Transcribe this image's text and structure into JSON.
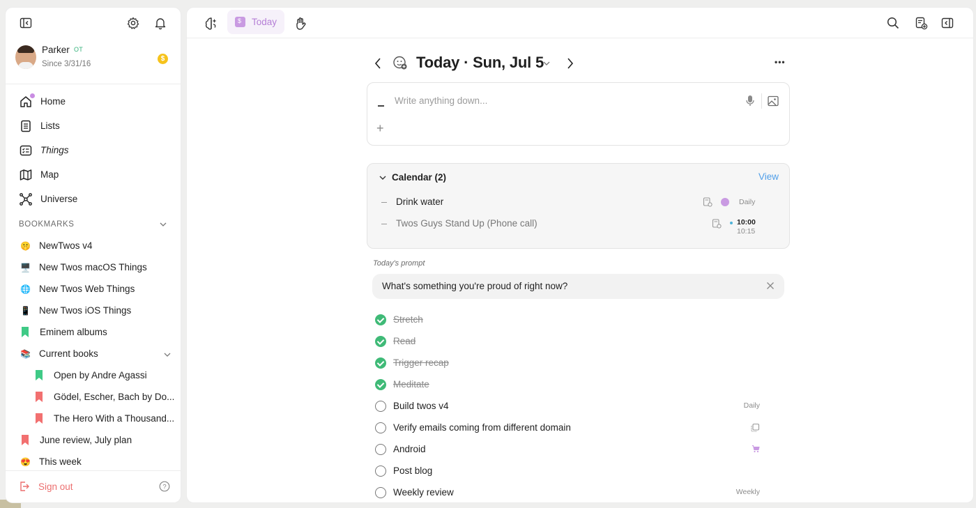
{
  "sidebar": {
    "icons": [
      "sidebar-toggle-icon",
      "gear-icon",
      "bell-icon"
    ],
    "profile": {
      "name": "Parker",
      "badge": "OT",
      "since": "Since 3/31/16",
      "coin": "$"
    },
    "nav": [
      {
        "label": "Home",
        "icon": "home-icon"
      },
      {
        "label": "Lists",
        "icon": "list-icon"
      },
      {
        "label": "Things",
        "icon": "things-icon"
      },
      {
        "label": "Map",
        "icon": "map-icon"
      },
      {
        "label": "Universe",
        "icon": "universe-icon"
      }
    ],
    "bookmarks_heading": "BOOKMARKS",
    "bookmarks": [
      {
        "label": "NewTwos v4",
        "emoji": "🤫"
      },
      {
        "label": "New Twos macOS Things",
        "emoji": "🖥️"
      },
      {
        "label": "New Twos Web Things",
        "emoji": "🌐"
      },
      {
        "label": "New Twos iOS Things",
        "emoji": "📱"
      },
      {
        "label": "Eminem albums",
        "color": "#3fca86"
      },
      {
        "label": "Current books",
        "emoji": "📚"
      },
      {
        "label": "Open by Andre Agassi",
        "color": "#3fca86"
      },
      {
        "label": "Gödel, Escher, Bach by Do...",
        "color": "#f27070"
      },
      {
        "label": "The Hero With a Thousand...",
        "color": "#f27070"
      },
      {
        "label": "June review, July plan",
        "color": "#f27070"
      },
      {
        "label": "This week",
        "emoji": "😍"
      }
    ],
    "signout": "Sign out",
    "help": "?"
  },
  "topbar": {
    "today_tab": "Today"
  },
  "heading": {
    "title": "Today · Sun, Jul 5",
    "more": "•••"
  },
  "editor": {
    "placeholder": "Write anything down...",
    "plus": "+"
  },
  "calendar": {
    "title": "Calendar (2)",
    "view": "View",
    "events": [
      {
        "title": "Drink water",
        "meta": "Daily"
      },
      {
        "title": "Twos Guys Stand Up (Phone call)",
        "start": "10:00",
        "end": "10:15"
      }
    ]
  },
  "prompt": {
    "label": "Today's prompt",
    "text": "What's something you're proud of right now?"
  },
  "tasks": [
    {
      "label": "Stretch",
      "done": true,
      "meta": ""
    },
    {
      "label": "Read",
      "done": true,
      "meta": ""
    },
    {
      "label": "Trigger recap",
      "done": true,
      "meta": ""
    },
    {
      "label": "Meditate",
      "done": true,
      "meta": ""
    },
    {
      "label": "Build twos v4",
      "done": false,
      "meta": "Daily"
    },
    {
      "label": "Verify emails coming from different domain",
      "done": false,
      "meta": ""
    },
    {
      "label": "Android",
      "done": false,
      "meta": ""
    },
    {
      "label": "Post blog",
      "done": false,
      "meta": ""
    },
    {
      "label": "Weekly review",
      "done": false,
      "meta": "Weekly"
    }
  ],
  "colors": {
    "accent": "#b57fd6",
    "done": "#3fba77",
    "link": "#4f9ee8",
    "signout": "#ec6f6f"
  }
}
